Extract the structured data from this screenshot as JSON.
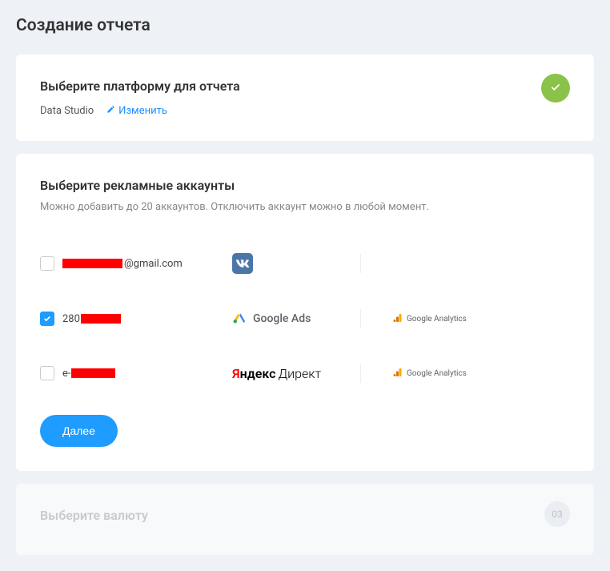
{
  "page_title": "Создание отчета",
  "step1": {
    "title": "Выберите платформу для отчета",
    "value": "Data Studio",
    "edit_label": "Изменить"
  },
  "step2": {
    "title": "Выберите рекламные аккаунты",
    "description": "Можно добавить до 20 аккаунтов. Отключить аккаунт можно в любой момент.",
    "accounts": [
      {
        "checked": false,
        "email_suffix": "@gmail.com",
        "platform": "vk",
        "analytics": ""
      },
      {
        "checked": true,
        "prefix": "280",
        "platform": "google_ads",
        "platform_label": "Google Ads",
        "analytics": "Google Analytics"
      },
      {
        "checked": false,
        "prefix": "e-",
        "platform": "yandex_direct",
        "yandex_ya": "Я",
        "yandex_ndex": "ндекс",
        "yandex_direct": "Директ",
        "analytics": "Google Analytics"
      }
    ],
    "next_button": "Далее"
  },
  "step3": {
    "title": "Выберите валюту",
    "number": "03"
  }
}
